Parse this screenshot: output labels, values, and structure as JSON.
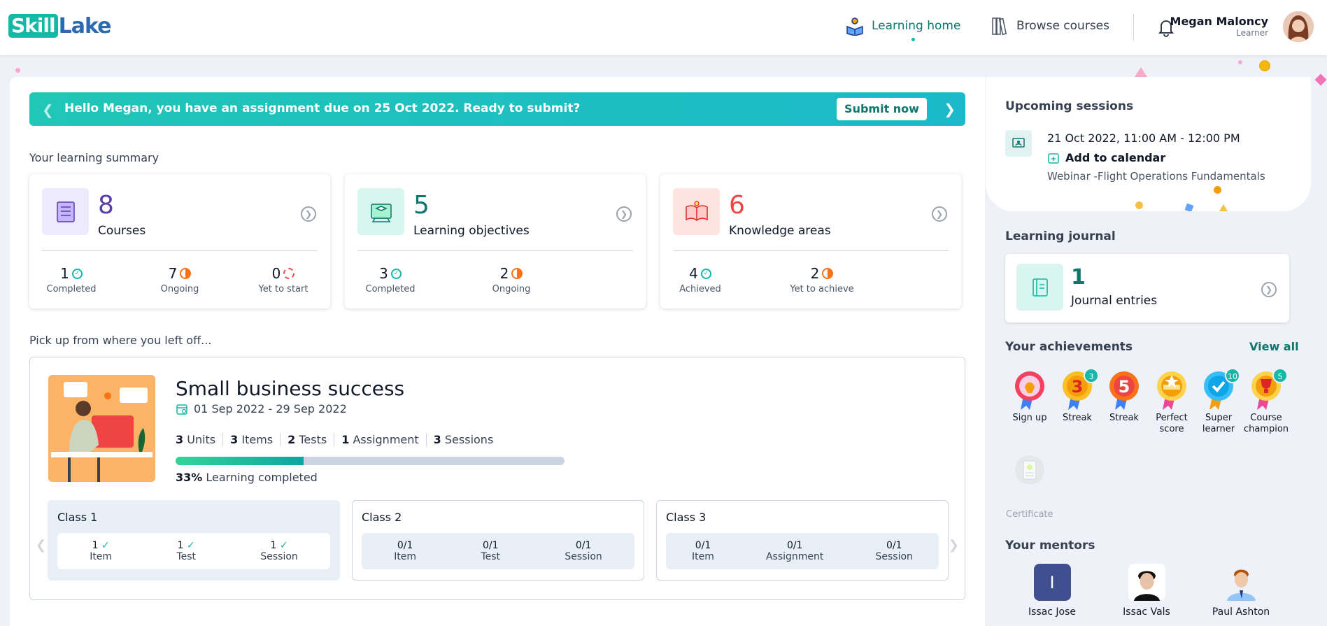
{
  "header": {
    "logo_skill": "Skill",
    "logo_lake": "Lake",
    "nav_learning_home": "Learning home",
    "nav_browse_courses": "Browse courses",
    "user_name": "Megan Maloncy",
    "user_role": "Learner"
  },
  "banner": {
    "message": "Hello Megan, you have an assignment due on 25 Oct 2022. Ready to submit?",
    "button": "Submit now"
  },
  "summary": {
    "heading": "Your learning summary",
    "cards": [
      {
        "number": "8",
        "label": "Courses",
        "color": "#5b3ea8",
        "stats": [
          {
            "value": "1",
            "label": "Completed"
          },
          {
            "value": "7",
            "label": "Ongoing"
          },
          {
            "value": "0",
            "label": "Yet to start"
          }
        ]
      },
      {
        "number": "5",
        "label": "Learning objectives",
        "color": "#0f766e",
        "stats": [
          {
            "value": "3",
            "label": "Completed"
          },
          {
            "value": "2",
            "label": "Ongoing"
          }
        ]
      },
      {
        "number": "6",
        "label": "Knowledge areas",
        "color": "#ef4444",
        "stats": [
          {
            "value": "4",
            "label": "Achieved"
          },
          {
            "value": "2",
            "label": "Yet to achieve"
          }
        ]
      }
    ]
  },
  "resume": {
    "heading": "Pick up from where you left off...",
    "course": {
      "title": "Small business success",
      "dates": "01 Sep 2022 - 29 Sep 2022",
      "stats": [
        {
          "value": "3",
          "label": "Units"
        },
        {
          "value": "3",
          "label": "Items"
        },
        {
          "value": "2",
          "label": "Tests"
        },
        {
          "value": "1",
          "label": "Assignment"
        },
        {
          "value": "3",
          "label": "Sessions"
        }
      ],
      "progress_percent": 33,
      "progress_value": "33%",
      "progress_label": "Learning completed",
      "classes": [
        {
          "title": "Class 1",
          "stats": [
            {
              "value": "1",
              "label": "Item"
            },
            {
              "value": "1",
              "label": "Test"
            },
            {
              "value": "1",
              "label": "Session"
            }
          ]
        },
        {
          "title": "Class 2",
          "stats": [
            {
              "value": "0/1",
              "label": "Item"
            },
            {
              "value": "0/1",
              "label": "Test"
            },
            {
              "value": "0/1",
              "label": "Session"
            }
          ]
        },
        {
          "title": "Class 3",
          "stats": [
            {
              "value": "0/1",
              "label": "Item"
            },
            {
              "value": "0/1",
              "label": "Assignment"
            },
            {
              "value": "0/1",
              "label": "Session"
            }
          ]
        }
      ]
    }
  },
  "upcoming": {
    "heading": "Upcoming sessions",
    "time": "21 Oct 2022, 11:00 AM - 12:00 PM",
    "add_to_calendar": "Add to calendar",
    "webinar": "Webinar -Flight Operations Fundamentals"
  },
  "journal": {
    "heading": "Learning journal",
    "number": "1",
    "label": "Journal entries"
  },
  "achievements": {
    "heading": "Your achievements",
    "view_all": "View all",
    "badges": [
      {
        "label": "Sign up",
        "icon": "sign-up-medal-icon"
      },
      {
        "label": "Streak",
        "icon": "streak-3-medal-icon",
        "count": "3",
        "digit": "3"
      },
      {
        "label": "Streak",
        "icon": "streak-5-medal-icon",
        "digit": "5"
      },
      {
        "label": "Perfect score",
        "icon": "perfect-score-medal-icon"
      },
      {
        "label": "Super learner",
        "icon": "super-learner-medal-icon",
        "count": "10"
      },
      {
        "label": "Course champion",
        "icon": "course-champion-medal-icon",
        "count": "5"
      }
    ],
    "certificate": "Certificate"
  },
  "mentors": {
    "heading": "Your mentors",
    "list": [
      {
        "name": "Issac Jose",
        "initial": "I"
      },
      {
        "name": "Issac Vals"
      },
      {
        "name": "Paul Ashton"
      }
    ]
  }
}
